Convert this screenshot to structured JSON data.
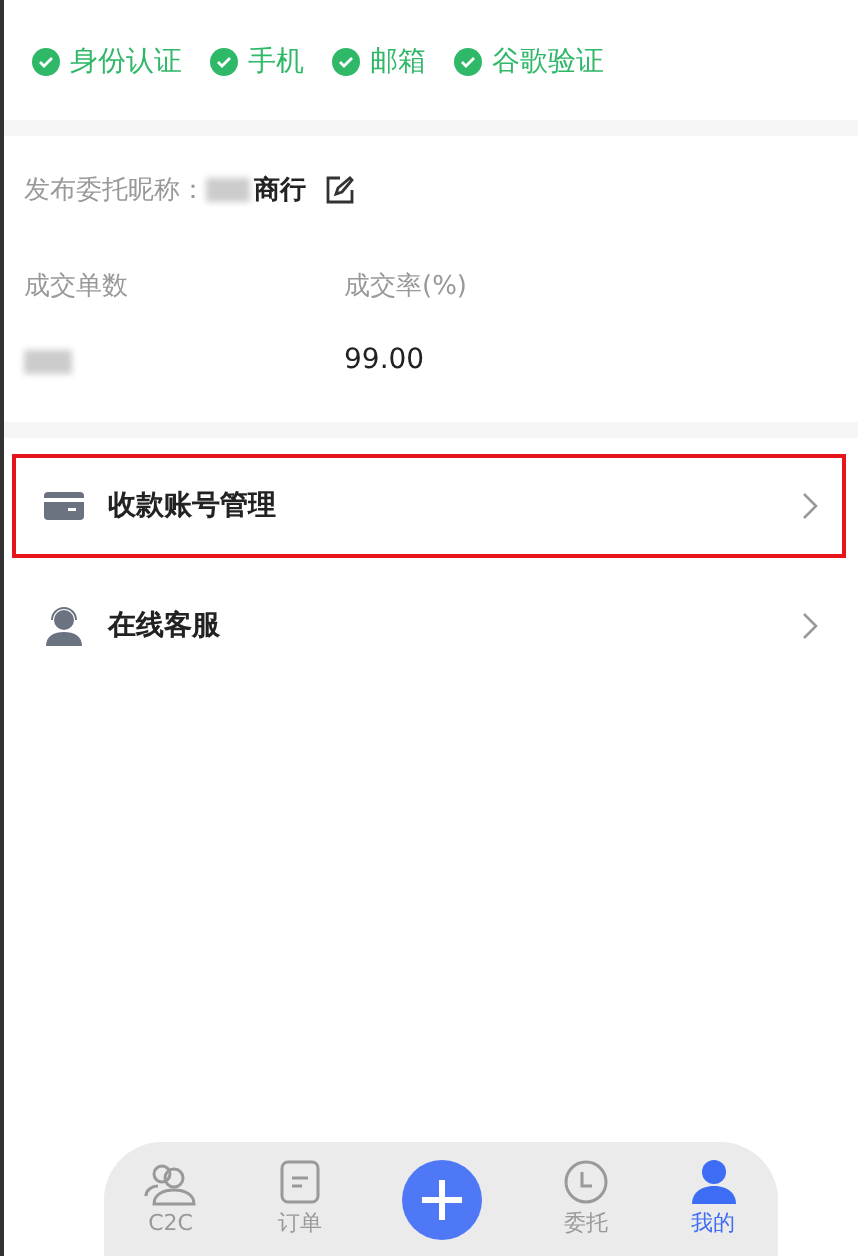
{
  "verifications": [
    {
      "label": "身份认证",
      "verified": true
    },
    {
      "label": "手机",
      "verified": true
    },
    {
      "label": "邮箱",
      "verified": true
    },
    {
      "label": "谷歌验证",
      "verified": true
    }
  ],
  "nickname": {
    "label": "发布委托昵称：",
    "value": "商行"
  },
  "stats": [
    {
      "label": "成交单数",
      "redacted": true
    },
    {
      "label": "成交率(%)",
      "value": "99.00"
    }
  ],
  "menu": [
    {
      "kind": "card",
      "label": "收款账号管理",
      "highlighted": true
    },
    {
      "kind": "support",
      "label": "在线客服",
      "highlighted": false
    }
  ],
  "tabbar": [
    {
      "kind": "people",
      "label": "C2C",
      "selected": false
    },
    {
      "kind": "note",
      "label": "订单",
      "selected": false
    },
    {
      "kind": "plus"
    },
    {
      "kind": "clock",
      "label": "委托",
      "selected": false
    },
    {
      "kind": "person",
      "label": "我的",
      "selected": true
    }
  ]
}
